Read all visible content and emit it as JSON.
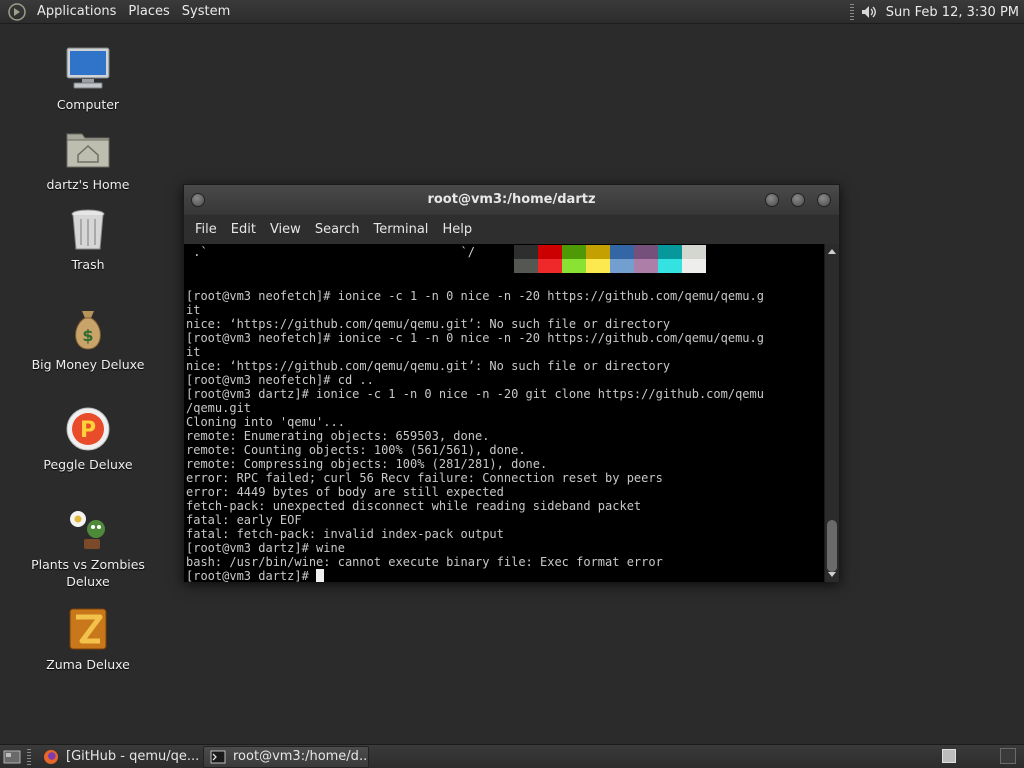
{
  "top_panel": {
    "logo_icon": "gnome-foot-icon",
    "menus": [
      "Applications",
      "Places",
      "System"
    ],
    "volume_icon": "speaker-icon",
    "clock": "Sun Feb 12,  3:30 PM"
  },
  "desktop_icons": [
    {
      "label": "Computer",
      "icon": "computer-icon"
    },
    {
      "label": "dartz's Home",
      "icon": "home-folder-icon"
    },
    {
      "label": "Trash",
      "icon": "trash-icon"
    },
    {
      "label": "Big Money Deluxe",
      "icon": "money-bag-icon"
    },
    {
      "label": "Peggle Deluxe",
      "icon": "peggle-icon"
    },
    {
      "label": "Plants vs Zombies Deluxe",
      "icon": "plants-vs-zombies-icon"
    },
    {
      "label": "Zuma Deluxe",
      "icon": "zuma-icon"
    }
  ],
  "terminal": {
    "title": "root@vm3:/home/dartz",
    "menu": [
      "File",
      "Edit",
      "View",
      "Search",
      "Terminal",
      "Help"
    ],
    "fragment_line": " .`                                   `/",
    "palette": {
      "row1": [
        "#2e2e2e",
        "#cc0000",
        "#4e9a06",
        "#c4a000",
        "#3465a4",
        "#75507b",
        "#06989a",
        "#d3d7cf"
      ],
      "row2": [
        "#555753",
        "#ef2929",
        "#8ae234",
        "#fce94f",
        "#729fcf",
        "#ad7fa8",
        "#34e2e2",
        "#eeeeec"
      ]
    },
    "lines": [
      "[root@vm3 neofetch]# ionice -c 1 -n 0 nice -n -20 https://github.com/qemu/qemu.g",
      "it",
      "nice: ‘https://github.com/qemu/qemu.git’: No such file or directory",
      "[root@vm3 neofetch]# ionice -c 1 -n 0 nice -n -20 https://github.com/qemu/qemu.g",
      "it",
      "nice: ‘https://github.com/qemu/qemu.git’: No such file or directory",
      "[root@vm3 neofetch]# cd ..",
      "[root@vm3 dartz]# ionice -c 1 -n 0 nice -n -20 git clone https://github.com/qemu",
      "/qemu.git",
      "Cloning into 'qemu'...",
      "remote: Enumerating objects: 659503, done.",
      "remote: Counting objects: 100% (561/561), done.",
      "remote: Compressing objects: 100% (281/281), done.",
      "error: RPC failed; curl 56 Recv failure: Connection reset by peers",
      "error: 4449 bytes of body are still expected",
      "fetch-pack: unexpected disconnect while reading sideband packet",
      "fatal: early EOF",
      "fatal: fetch-pack: invalid index-pack output",
      "[root@vm3 dartz]# wine",
      "bash: /usr/bin/wine: cannot execute binary file: Exec format error"
    ],
    "prompt": "[root@vm3 dartz]# "
  },
  "taskbar": {
    "show_desktop_icon": "show-desktop-icon",
    "tasks": [
      {
        "label": "[GitHub - qemu/qe...",
        "icon": "firefox-icon",
        "active": false
      },
      {
        "label": "root@vm3:/home/d...",
        "icon": "terminal-icon",
        "active": true
      }
    ],
    "workspace_icon": "workspace-switcher-icon",
    "trash_icon": "trash-applet-icon"
  }
}
